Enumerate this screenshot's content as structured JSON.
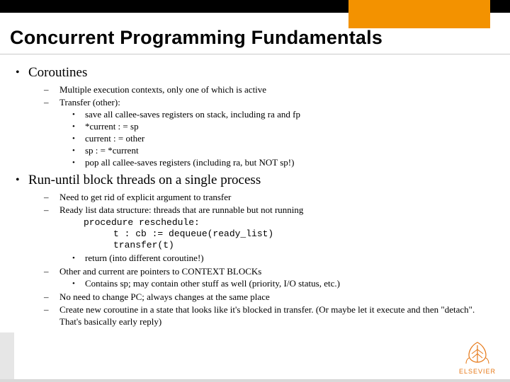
{
  "title": "Concurrent Programming Fundamentals",
  "sections": [
    {
      "heading": "Coroutines",
      "items": [
        {
          "text": "Multiple execution contexts, only one of which is active"
        },
        {
          "text": "Transfer (other):",
          "sub": [
            "save all callee-saves registers on stack, including ra and fp",
            "*current : = sp",
            "current : = other",
            "sp : = *current",
            "pop all callee-saves registers (including ra, but NOT sp!)"
          ]
        }
      ]
    },
    {
      "heading": "Run-until block threads on a single process",
      "items": [
        {
          "text": "Need to get rid of explicit argument to transfer"
        },
        {
          "text": "Ready list data structure: threads that are runnable but not running",
          "code": [
            "procedure reschedule:",
            "t : cb := dequeue(ready_list)",
            "transfer(t)"
          ],
          "sub": [
            "return (into different coroutine!)"
          ]
        },
        {
          "text": "Other and current are pointers to CONTEXT BLOCKs",
          "sub": [
            "Contains sp; may contain other stuff as well (priority, I/O status, etc.)"
          ]
        },
        {
          "text": "No need to change PC; always changes at the same place"
        },
        {
          "text": "Create new coroutine in a state that looks like it's blocked in transfer.  (Or maybe let it execute and then \"detach\".  That's basically early reply)"
        }
      ]
    }
  ],
  "logo_label": "ELSEVIER"
}
